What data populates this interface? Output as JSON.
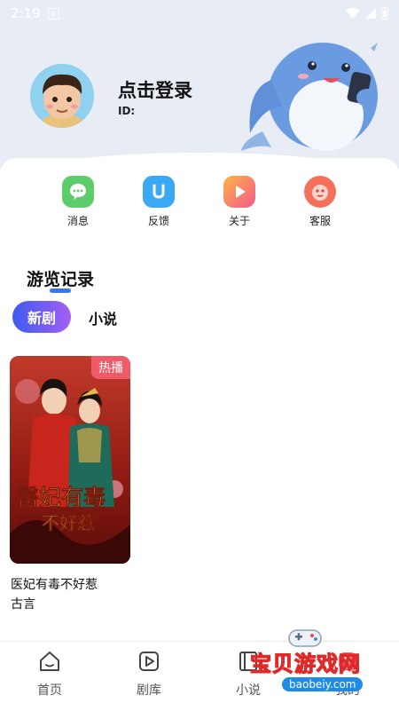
{
  "status_bar": {
    "time": "2:19"
  },
  "profile": {
    "login_label": "点击登录",
    "id_label": "ID:"
  },
  "quick_actions": [
    {
      "label": "消息",
      "icon": "message-icon",
      "color": "#5ccd6a"
    },
    {
      "label": "反馈",
      "icon": "feedback-icon",
      "color": "#3aa8f2"
    },
    {
      "label": "关于",
      "icon": "about-icon",
      "color": "#f25a8a"
    },
    {
      "label": "客服",
      "icon": "customer-service-icon",
      "color": "#f5705a"
    }
  ],
  "history": {
    "title": "游览记录",
    "tabs": [
      {
        "label": "新剧"
      },
      {
        "label": "小说"
      }
    ],
    "items": [
      {
        "badge": "热播",
        "title": "医妃有毒不好惹",
        "genre": "古言"
      }
    ]
  },
  "poster_art_text": {
    "line1": "醫妃有毒",
    "line2": "不好惹"
  },
  "bottom_nav": [
    {
      "label": "首页",
      "icon": "home-icon"
    },
    {
      "label": "剧库",
      "icon": "play-library-icon"
    },
    {
      "label": "小说",
      "icon": "book-icon"
    },
    {
      "label": "我的",
      "icon": "profile-icon"
    }
  ],
  "watermark": {
    "text": "宝贝游戏网",
    "url": "baobeiy.com"
  },
  "colors": {
    "accent": "#3a76f0",
    "badge": "#ee5a67",
    "tab_gradient_start": "#3e5bf0",
    "tab_gradient_end": "#a35ff2"
  }
}
